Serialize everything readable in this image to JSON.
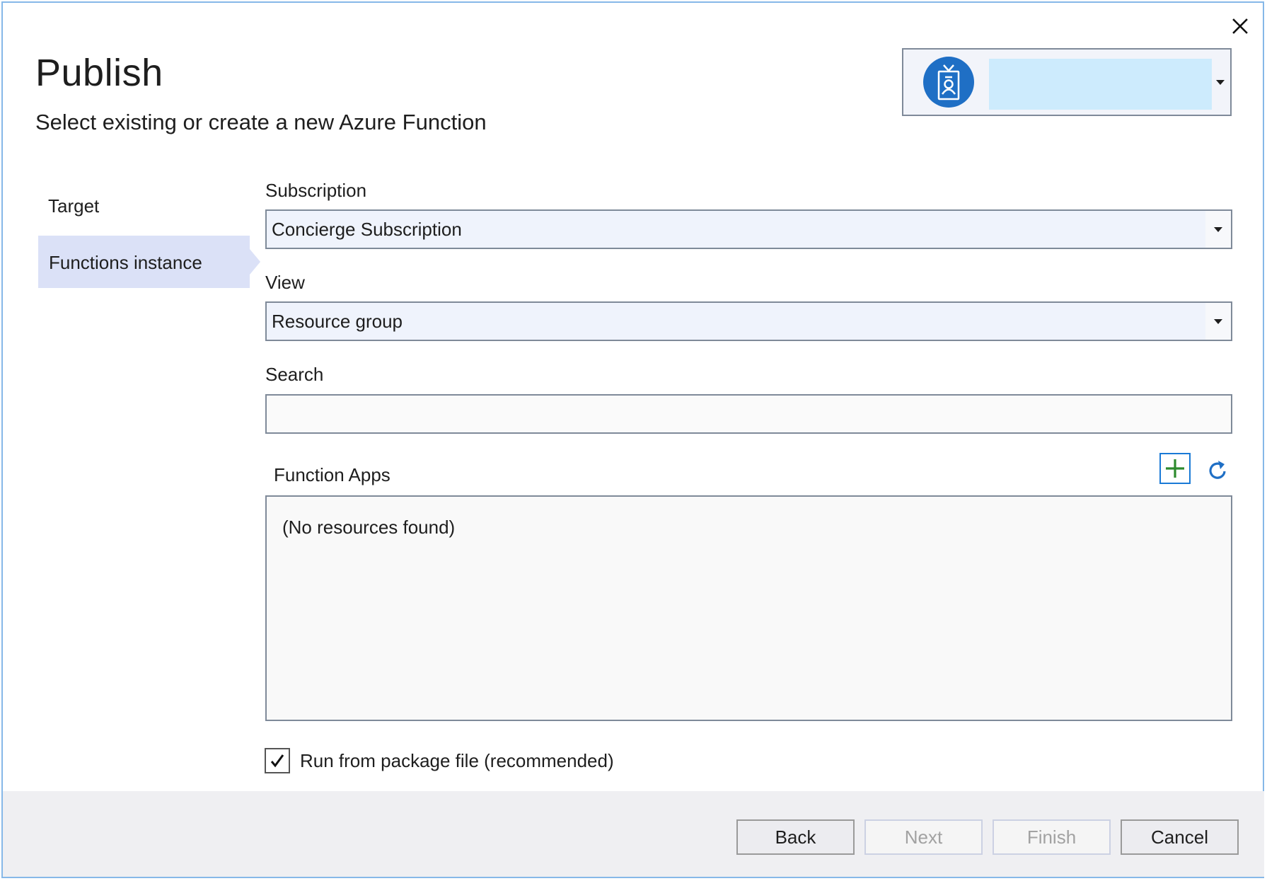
{
  "dialog": {
    "title": "Publish",
    "subtitle": "Select existing or create a new Azure Function",
    "close_icon": "close-icon"
  },
  "account": {
    "avatar_icon": "id-badge-icon",
    "name": "",
    "redacted": true,
    "avatar_color": "#1f6fc5",
    "redaction_color": "#cdebfd"
  },
  "sidebar": {
    "items": [
      {
        "label": "Target",
        "selected": false
      },
      {
        "label": "Functions instance",
        "selected": true
      }
    ],
    "selected_color": "#dbe1f7"
  },
  "form": {
    "subscription": {
      "label": "Subscription",
      "value": "Concierge Subscription"
    },
    "view": {
      "label": "View",
      "value": "Resource group"
    },
    "search": {
      "label": "Search",
      "value": "",
      "placeholder": ""
    },
    "function_apps": {
      "label": "Function Apps",
      "empty_text": "(No resources found)",
      "add_icon": "add-icon",
      "refresh_icon": "refresh-icon"
    },
    "run_from_package": {
      "label": "Run from package file (recommended)",
      "checked": true
    }
  },
  "footer": {
    "buttons": [
      {
        "label": "Back",
        "enabled": true
      },
      {
        "label": "Next",
        "enabled": false
      },
      {
        "label": "Finish",
        "enabled": false
      },
      {
        "label": "Cancel",
        "enabled": true
      }
    ]
  },
  "colors": {
    "window_border": "#86b8e8",
    "add_icon": "#2e8b2e",
    "refresh_icon": "#1f6fc5"
  }
}
